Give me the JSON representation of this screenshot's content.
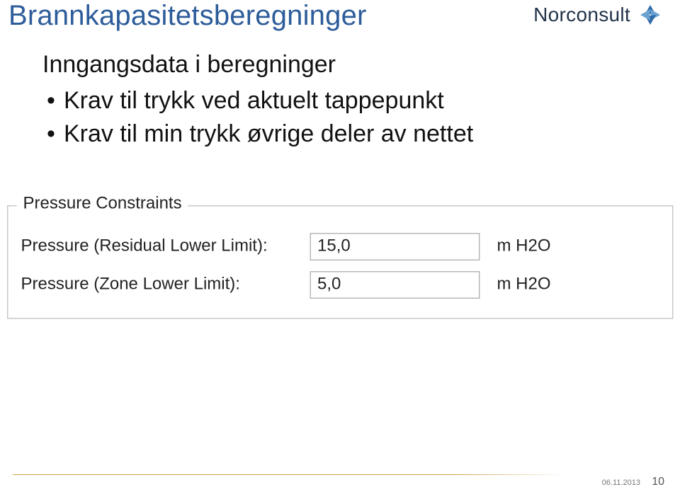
{
  "header": {
    "title": "Brannkapasitetsberegninger",
    "brand": "Norconsult"
  },
  "content": {
    "lead": "Inngangsdata i beregninger",
    "bullets": [
      "Krav til trykk ved aktuelt tappepunkt",
      "Krav til min trykk øvrige deler av nettet"
    ]
  },
  "panel": {
    "legend": "Pressure Constraints",
    "rows": [
      {
        "label": "Pressure (Residual Lower Limit):",
        "value": "15,0",
        "unit": "m H2O"
      },
      {
        "label": "Pressure (Zone Lower Limit):",
        "value": "5,0",
        "unit": "m H2O"
      }
    ]
  },
  "footer": {
    "date": "06.11.2013",
    "page": "10"
  }
}
